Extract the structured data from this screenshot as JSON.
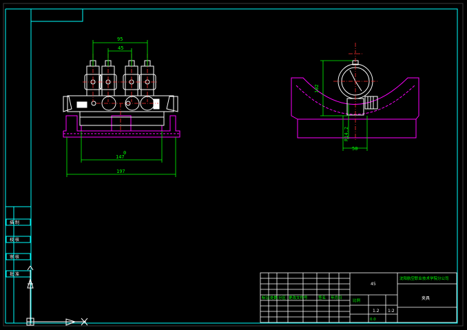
{
  "dimensions": {
    "front_top_outer": "95",
    "front_top_inner": "45",
    "front_bottom_inner": "147",
    "front_bottom_outer": "197",
    "front_small": "0",
    "side_height": "102",
    "side_radius": "R14.2",
    "side_width": "50"
  },
  "side_strip": {
    "label_1": "描 制",
    "label_2": "校 核",
    "label_3": "审 核",
    "label_4": "批 准"
  },
  "title_block": {
    "material": "45",
    "company": "沈阳航空职业技术学院分公司",
    "part_name": "夹具",
    "scale_label": "比例",
    "scale_value": "1:2",
    "sheet_count": "1.2",
    "row_cells": [
      "标记",
      "处数",
      "分区",
      "更改文件号",
      "签名",
      "年月日"
    ],
    "weight": "0.0"
  },
  "colors": {
    "border": "#00ffff",
    "part": "#ffffff",
    "base": "#ff00ff",
    "dimension": "#00ff00",
    "centerline": "#ff3030"
  }
}
